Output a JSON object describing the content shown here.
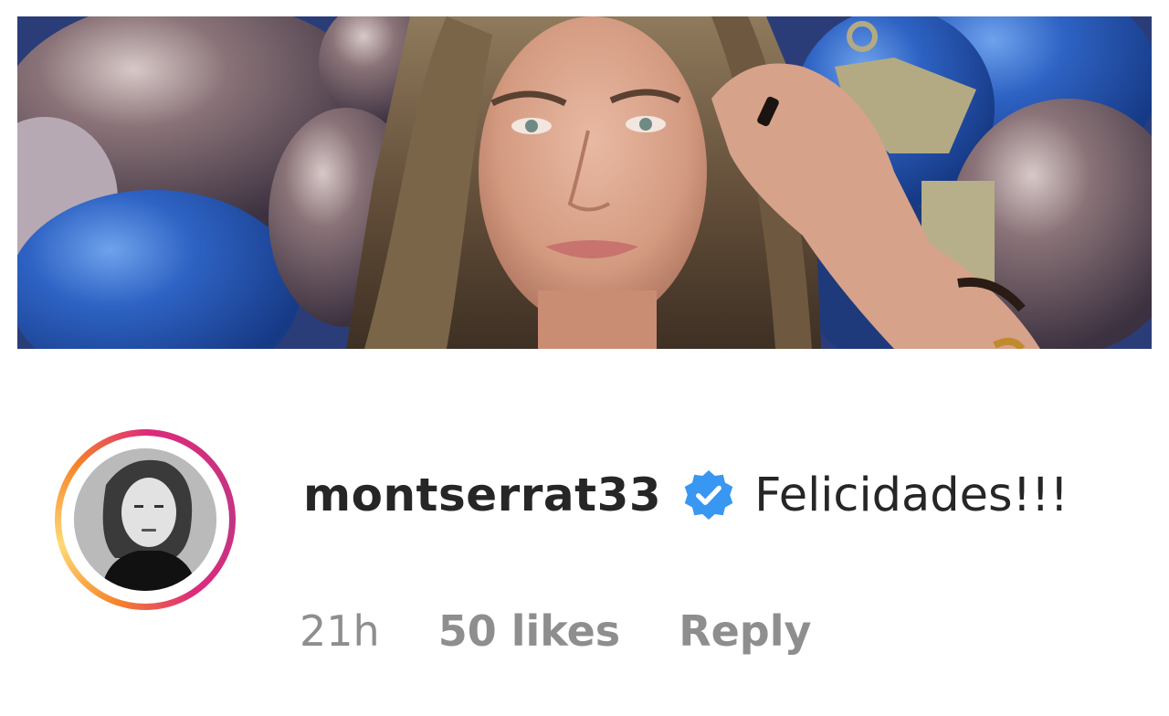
{
  "post_image": {
    "subject": "woman-portrait-with-balloons"
  },
  "comment": {
    "username": "montserrat33",
    "verified_icon": "verified-badge-icon",
    "verified_color": "#3897f0",
    "text": "Felicidades!!!",
    "time": "21h",
    "likes": "50 likes",
    "reply_label": "Reply"
  },
  "colors": {
    "text_primary": "#262626",
    "text_secondary": "#8e8e8e",
    "story_ring_start": "#f58529",
    "story_ring_end": "#dd2a7b"
  }
}
